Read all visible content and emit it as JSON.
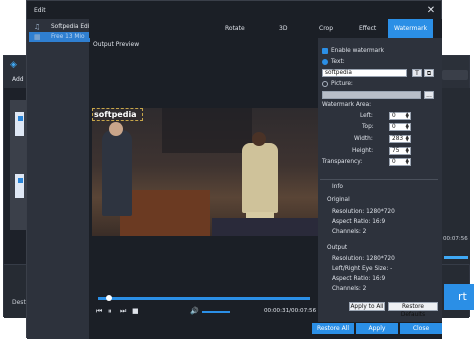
{
  "background_app": {
    "add_label": "Add",
    "p_label": "P",
    "dest_label": "Desti",
    "time": "00:07:56",
    "convert_label": "rt"
  },
  "dialog": {
    "title": "Edit",
    "close_icon": "close-icon"
  },
  "files": [
    {
      "name": "Softpedia Edit...",
      "icon": "music-note-icon"
    },
    {
      "name": "Free 13 Mio",
      "icon": "film-icon"
    }
  ],
  "tabs": [
    {
      "label": "Rotate"
    },
    {
      "label": "3D"
    },
    {
      "label": "Crop"
    },
    {
      "label": "Effect"
    },
    {
      "label": "Watermark",
      "active": true
    }
  ],
  "preview": {
    "label": "Output Preview",
    "watermark_text": "softpedia",
    "time": "00:00:31/00:07:56"
  },
  "watermark": {
    "enable_label": "Enable watermark",
    "text_label": "Text:",
    "text_value": "softpedia",
    "text_btn_1": "T",
    "text_btn_2": "⧉",
    "picture_label": "Picture:",
    "browse_label": "...",
    "area_label": "Watermark Area:",
    "left_label": "Left:",
    "left_value": "0",
    "top_label": "Top:",
    "top_value": "0",
    "width_label": "Width:",
    "width_value": "283",
    "height_label": "Height:",
    "height_value": "75",
    "transparency_label": "Transparency:",
    "transparency_value": "0"
  },
  "info": {
    "header": "Info",
    "original_header": "Original",
    "original_resolution": "Resolution: 1280*720",
    "original_aspect": "Aspect Ratio: 16:9",
    "original_channels": "Channels: 2",
    "output_header": "Output",
    "output_resolution": "Resolution: 1280*720",
    "output_eye": "Left/Right Eye Size: -",
    "output_aspect": "Aspect Ratio: 16:9",
    "output_channels": "Channels: 2"
  },
  "actions": {
    "apply_all": "Apply to All",
    "restore_defaults": "Restore Defaults"
  },
  "footer": {
    "restore_all": "Restore All",
    "apply": "Apply",
    "close": "Close"
  },
  "colors": {
    "accent": "#2b8fe6",
    "dialog_bg": "#1b1f26",
    "panel_bg": "#2d323c"
  }
}
